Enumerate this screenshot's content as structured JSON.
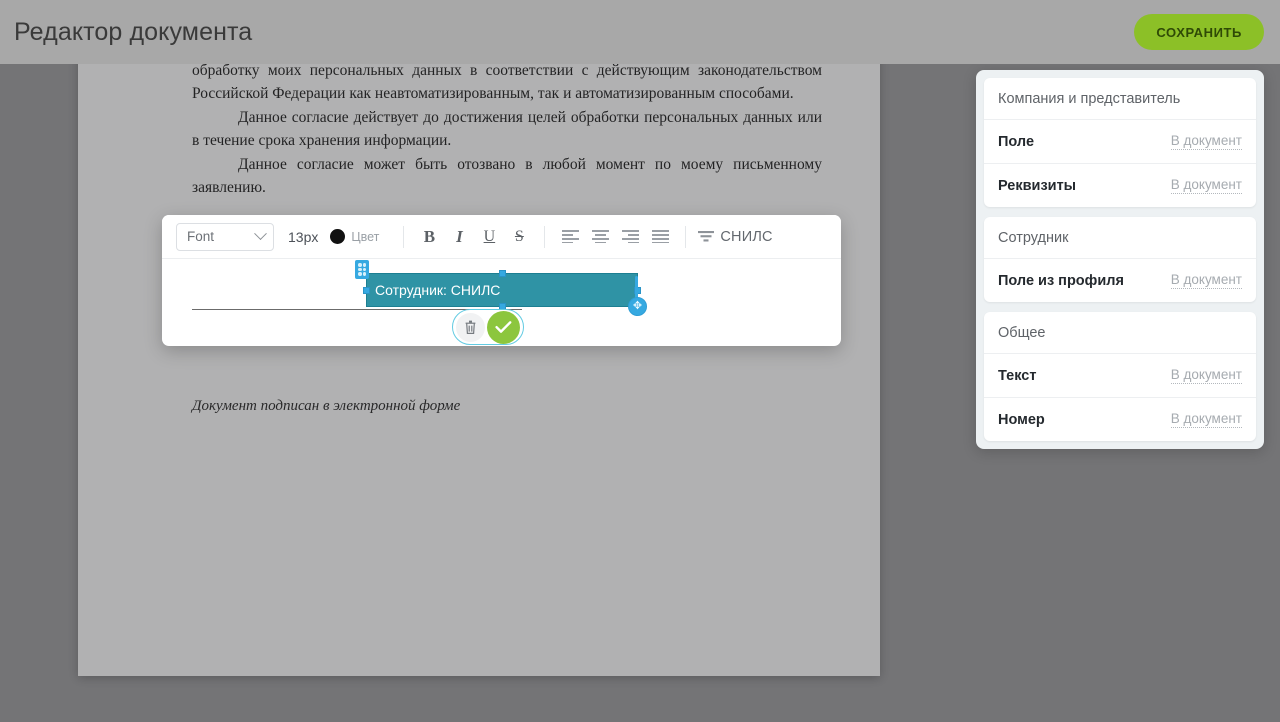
{
  "topbar": {
    "title": "Редактор документа",
    "save_label": "СОХРАНИТЬ",
    "save_color": "#8cc027"
  },
  "document": {
    "paragraphs": [
      "обработку моих персональных данных в соответствии с действующим законодательством Российской Федерации как неавтоматизированным, так и автоматизированным способами.",
      "Данное согласие действует до достижения целей обработки персональных данных или в течение срока хранения информации.",
      "Данное согласие может быть отозвано в любой момент по моему  письменному заявлению."
    ],
    "signed_note": "Документ подписан в электронной форме"
  },
  "toolbar": {
    "font_value": "Font",
    "font_size": "13px",
    "color_label": "Цвет",
    "color_value": "#111111",
    "bold_label": "B",
    "italic_label": "I",
    "underline_label": "U",
    "strike_label": "S",
    "align_left_label": "Align left",
    "align_center_label": "Align center",
    "align_right_label": "Align right",
    "align_justify_label": "Justify",
    "field_type_label": "СНИЛС"
  },
  "field": {
    "label": "Сотрудник: СНИЛС",
    "fill_color": "#2f93a5",
    "handle_color": "#36a9e1",
    "delete_label": "Удалить",
    "confirm_label": "Готово"
  },
  "side_panel": {
    "groups": [
      {
        "title": "Компания и представитель",
        "rows": [
          {
            "label": "Поле",
            "action": "В документ"
          },
          {
            "label": "Реквизиты",
            "action": "В документ"
          }
        ]
      },
      {
        "title": "Сотрудник",
        "rows": [
          {
            "label": "Поле из профиля",
            "action": "В документ"
          }
        ]
      },
      {
        "title": "Общее",
        "rows": [
          {
            "label": "Текст",
            "action": "В документ"
          },
          {
            "label": "Номер",
            "action": "В документ"
          }
        ]
      }
    ]
  }
}
